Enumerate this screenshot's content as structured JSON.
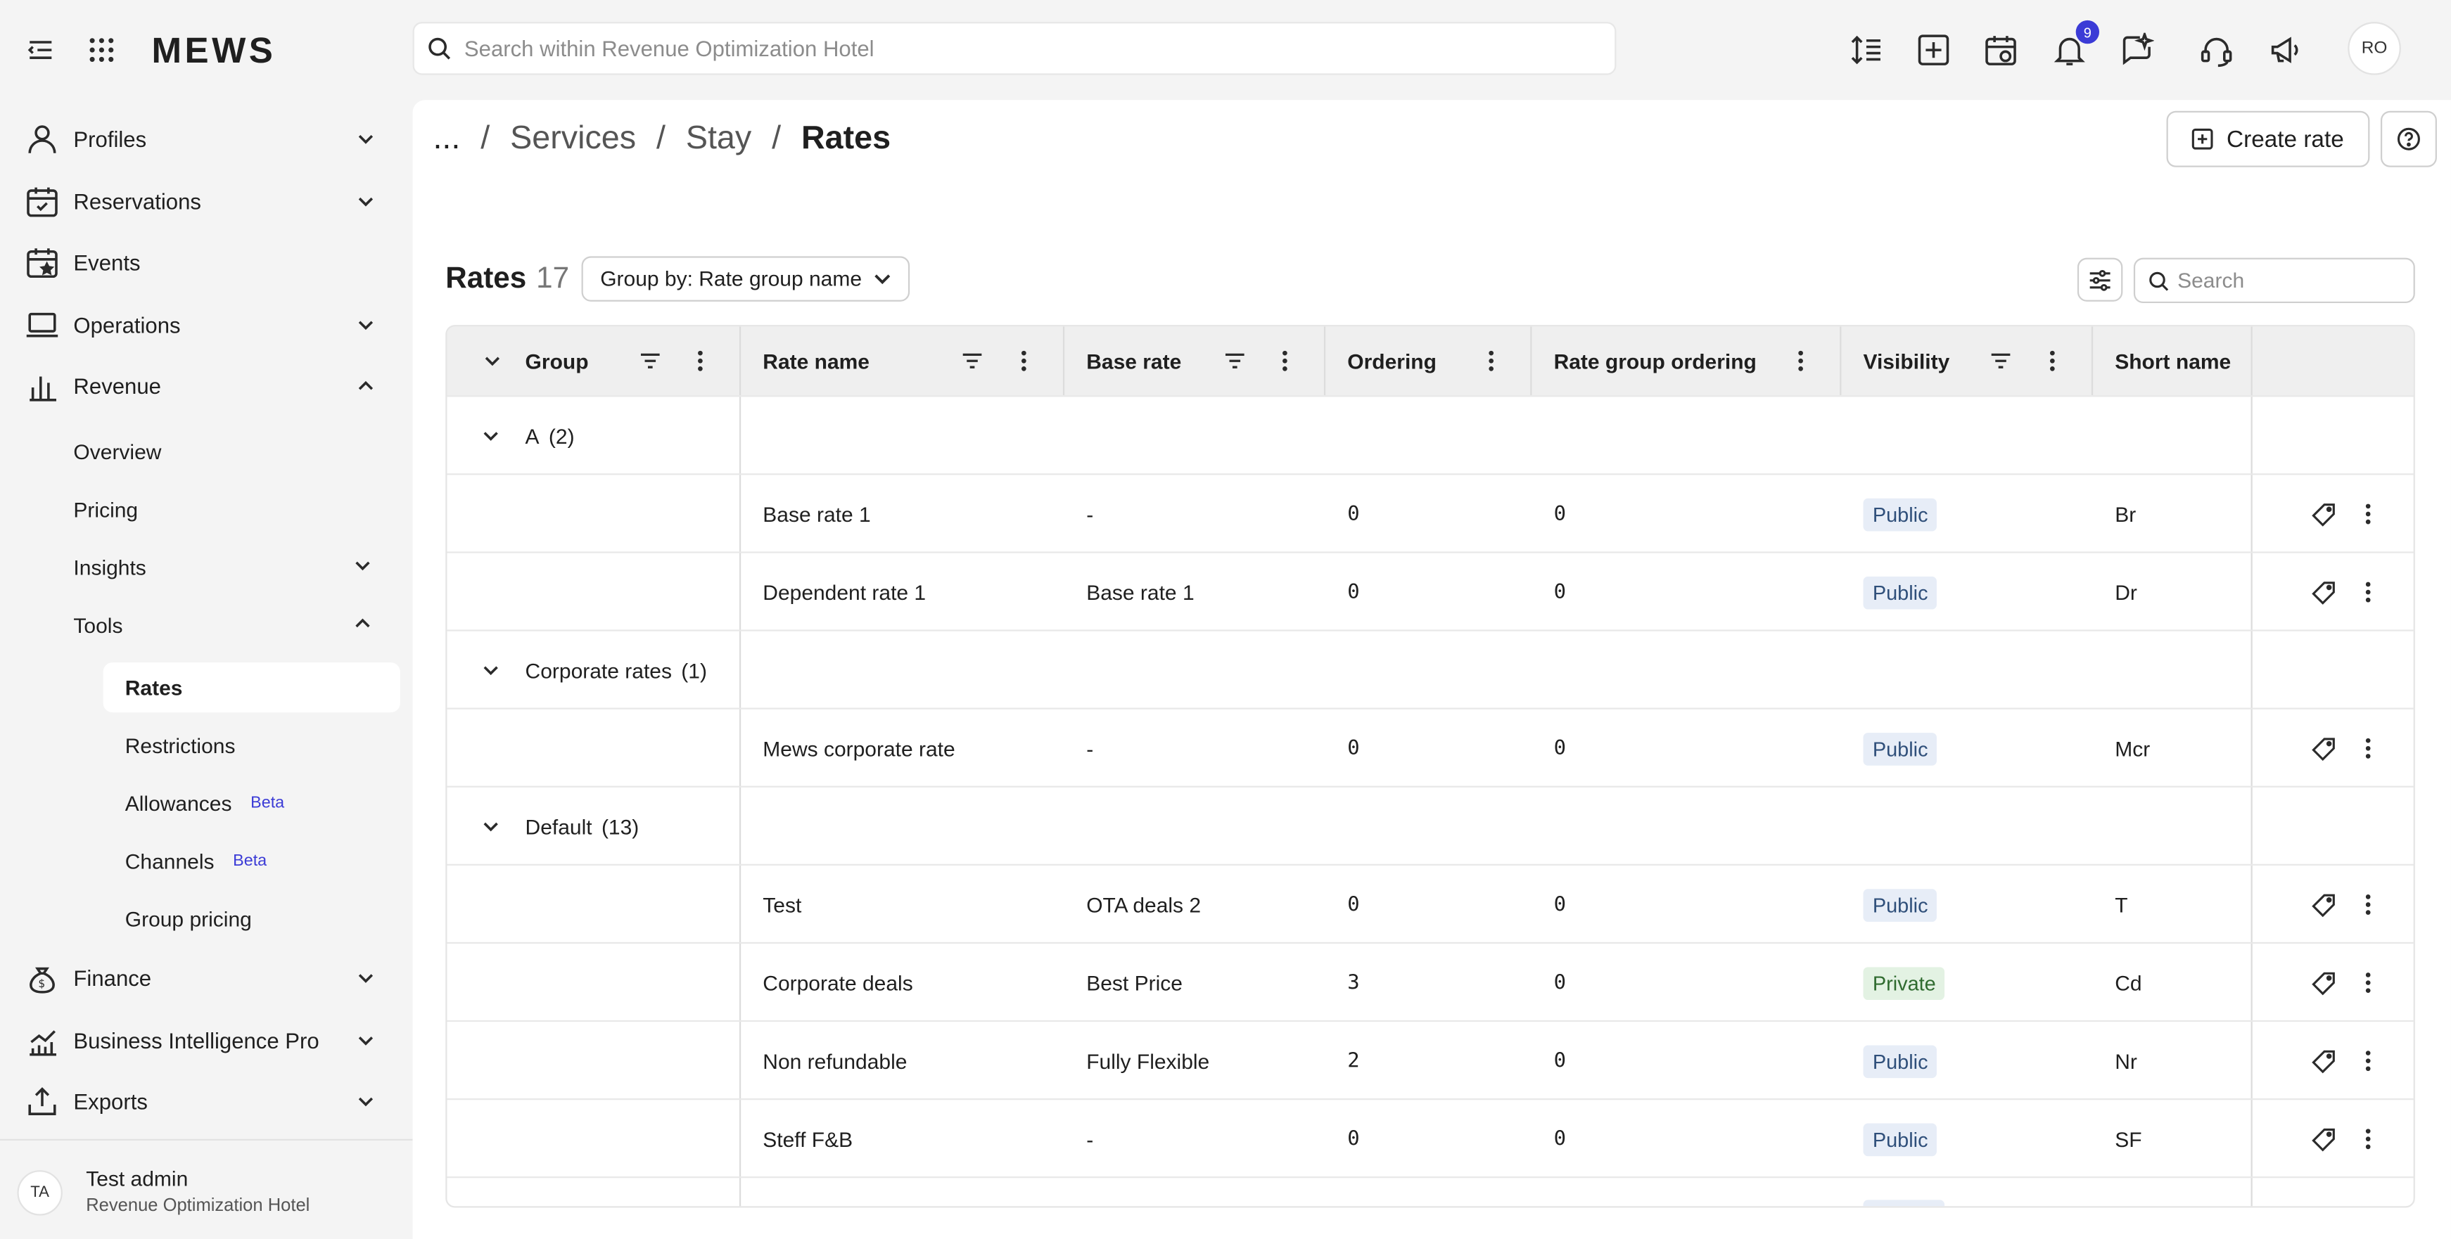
{
  "topbar": {
    "logo": "MEWS",
    "search_placeholder": "Search within Revenue Optimization Hotel",
    "notification_count": "9",
    "avatar_initials": "RO",
    "icons": [
      "menu-collapse-icon",
      "apps-grid-icon",
      "text-size-icon",
      "add-square-icon",
      "calendar-icon",
      "bell-icon",
      "sparkle-icon",
      "headset-icon",
      "megaphone-icon"
    ]
  },
  "sidebar": {
    "items": [
      {
        "label": "Profiles",
        "icon": "user-icon"
      },
      {
        "label": "Reservations",
        "icon": "calendar-check-icon"
      },
      {
        "label": "Events",
        "icon": "calendar-star-icon"
      },
      {
        "label": "Operations",
        "icon": "laptop-icon"
      },
      {
        "label": "Revenue",
        "icon": "bar-chart-icon"
      }
    ],
    "revenue_sub": {
      "overview": "Overview",
      "pricing": "Pricing",
      "insights": "Insights",
      "tools": "Tools"
    },
    "tools_sub": {
      "rates": "Rates",
      "restrictions": "Restrictions",
      "allowances": "Allowances",
      "channels": "Channels",
      "group_pricing": "Group pricing",
      "beta": "Beta"
    },
    "bottom_items": [
      {
        "label": "Finance",
        "icon": "money-bag-icon"
      },
      {
        "label": "Business Intelligence Pro",
        "icon": "trend-chart-icon"
      },
      {
        "label": "Exports",
        "icon": "export-icon"
      }
    ],
    "user": {
      "initials": "TA",
      "name": "Test admin",
      "hotel": "Revenue Optimization Hotel"
    }
  },
  "main": {
    "breadcrumb": {
      "root": "...",
      "sep": "/",
      "level1": "Services",
      "level2": "Stay",
      "current": "Rates"
    },
    "create_button": "Create rate",
    "title": "Rates",
    "count": "17",
    "groupby_label": "Group by: Rate group name",
    "search_placeholder": "Search"
  },
  "table": {
    "headers": {
      "group": "Group",
      "rate_name": "Rate name",
      "base_rate": "Base rate",
      "ordering": "Ordering",
      "rate_group_ordering": "Rate group ordering",
      "visibility": "Visibility",
      "short_name": "Short name"
    },
    "groups": [
      {
        "name": "A",
        "count": "(2)"
      },
      {
        "name": "Corporate rates",
        "count": "(1)"
      },
      {
        "name": "Default",
        "count": "(13)"
      }
    ],
    "rows": [
      {
        "rate_name": "Base rate 1",
        "base_rate": "-",
        "ordering": "0",
        "rate_group_ordering": "0",
        "visibility": "Public",
        "short_name": "Br"
      },
      {
        "rate_name": "Dependent rate 1",
        "base_rate": "Base rate 1",
        "ordering": "0",
        "rate_group_ordering": "0",
        "visibility": "Public",
        "short_name": "Dr"
      },
      {
        "rate_name": "Mews corporate rate",
        "base_rate": "-",
        "ordering": "0",
        "rate_group_ordering": "0",
        "visibility": "Public",
        "short_name": "Mcr"
      },
      {
        "rate_name": "Test",
        "base_rate": "OTA deals 2",
        "ordering": "0",
        "rate_group_ordering": "0",
        "visibility": "Public",
        "short_name": "T"
      },
      {
        "rate_name": "Corporate deals",
        "base_rate": "Best Price",
        "ordering": "3",
        "rate_group_ordering": "0",
        "visibility": "Private",
        "short_name": "Cd"
      },
      {
        "rate_name": "Non refundable",
        "base_rate": "Fully Flexible",
        "ordering": "2",
        "rate_group_ordering": "0",
        "visibility": "Public",
        "short_name": "Nr"
      },
      {
        "rate_name": "Steff F&B",
        "base_rate": "-",
        "ordering": "0",
        "rate_group_ordering": "0",
        "visibility": "Public",
        "short_name": "SF"
      }
    ]
  }
}
